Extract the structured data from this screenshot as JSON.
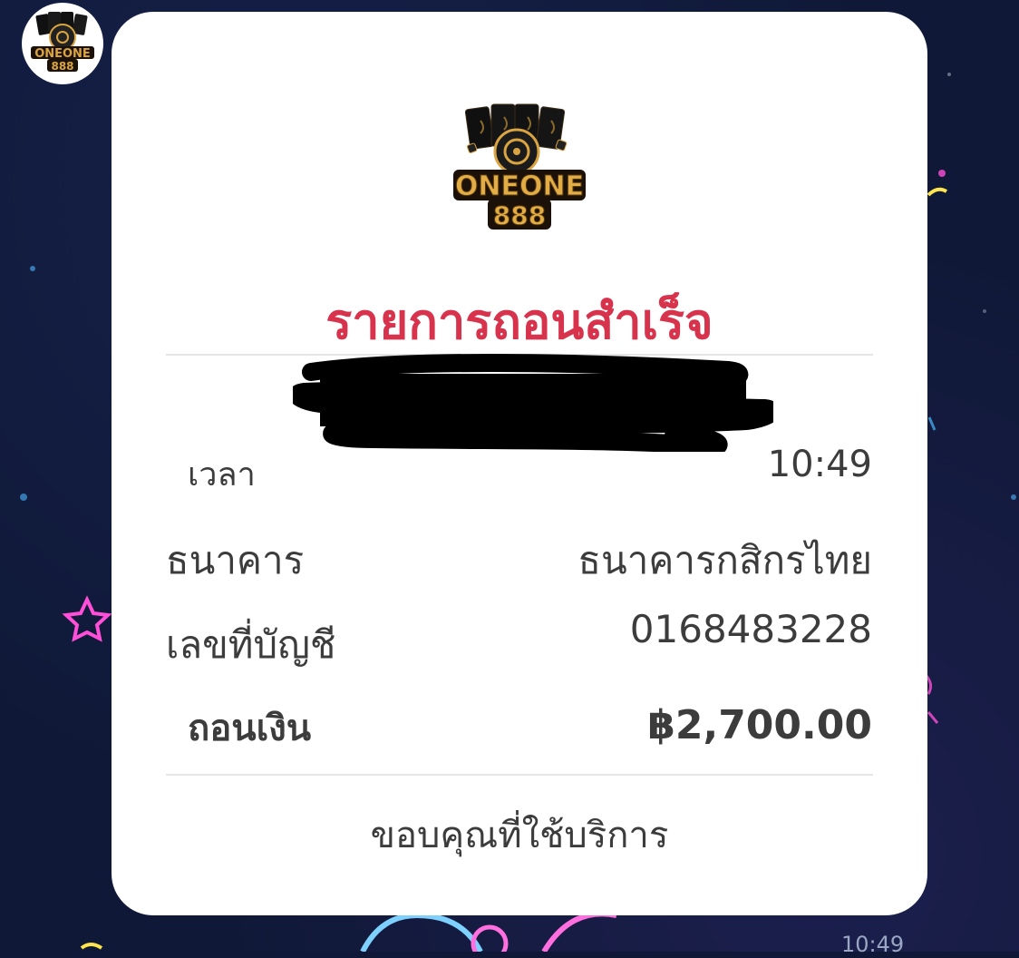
{
  "brand": {
    "logo_line1": "ONEONE",
    "logo_line2": "888"
  },
  "receipt": {
    "title": "รายการถอนสำเร็จ",
    "time_label": "เวลา",
    "time_value": "10:49",
    "bank_label": "ธนาคาร",
    "bank_value": "ธนาคารกสิกรไทย",
    "account_label": "เลขที่บัญชี",
    "account_value": "0168483228",
    "amount_label": "ถอนเงิน",
    "amount_value": "฿2,700.00",
    "thanks": "ขอบคุณที่ใช้บริการ"
  },
  "message": {
    "timestamp": "10:49"
  },
  "colors": {
    "background": "#0f1836",
    "bubble": "#ffffff",
    "title": "#d8334d",
    "text": "#3c3c3c",
    "divider": "#e6e6e6",
    "logo_gold": "#d9a441",
    "neon_pink": "#ff4fd8",
    "neon_blue": "#4fb8ff",
    "neon_yellow": "#ffe44d"
  },
  "icons": {
    "avatar": "oneone888-logo-icon",
    "logo": "oneone888-logo-icon"
  }
}
